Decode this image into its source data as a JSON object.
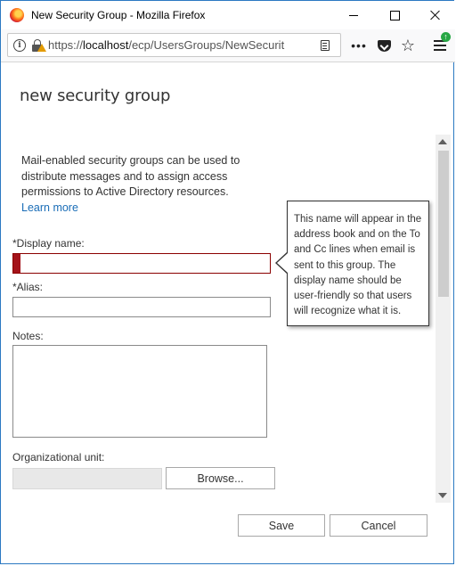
{
  "window": {
    "title": "New Security Group - Mozilla Firefox"
  },
  "browser": {
    "url_prefix": "https://",
    "url_host": "localhost",
    "url_path": "/ecp/UsersGroups/NewSecurit"
  },
  "page": {
    "title": "new security group",
    "intro_text": "Mail-enabled security groups can be used to distribute messages and to assign access permissions to Active Directory resources.",
    "learn_more_link": "Learn more",
    "display_name_label": "*Display name:",
    "display_name_value": "",
    "alias_label": "*Alias:",
    "alias_value": "",
    "notes_label": "Notes:",
    "notes_value": "",
    "ou_label": "Organizational unit:",
    "ou_value": "",
    "browse_button": "Browse...",
    "tooltip": "This name will appear in the address book and on the To and Cc lines when email is sent to this group. The display name should be user-friendly so that users will recognize what it is."
  },
  "footer": {
    "save_button": "Save",
    "cancel_button": "Cancel"
  },
  "colors": {
    "error_marker": "#a4131a",
    "link": "#1a6db7",
    "window_border": "#2b79c2"
  }
}
